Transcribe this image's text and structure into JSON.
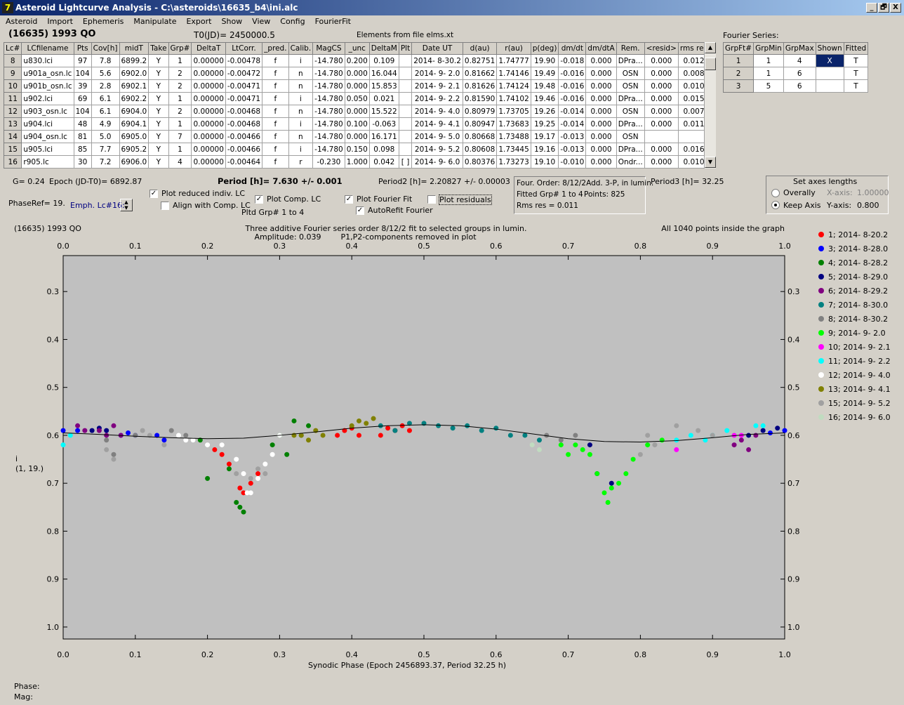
{
  "window": {
    "title": "Asteroid Lightcurve Analysis - C:\\asteroids\\16635_b4\\ini.alc",
    "controls": [
      "_",
      "🗗",
      "X"
    ]
  },
  "menu": [
    "Asteroid",
    "Import",
    "Ephemeris",
    "Manipulate",
    "Export",
    "Show",
    "View",
    "Config",
    "FourierFit"
  ],
  "header": {
    "asteroid": "(16635) 1993 QO",
    "t0": "T0(JD)= 2450000.5",
    "elements": "Elements from file elms.xt"
  },
  "lc_table": {
    "columns": [
      "Lc#",
      "LCfilename",
      "Pts",
      "Cov[h]",
      "midT",
      "Take",
      "Grp#",
      "DeltaT",
      "LtCorr.",
      "_pred.",
      "Calib.",
      "MagCS",
      "_unc",
      "DeltaM",
      "Plt",
      "Date UT",
      "d(au)",
      "r(au)",
      "p(deg)",
      "dm/dt",
      "dm/dtA",
      "Rem.",
      "<resid>",
      "rms res"
    ],
    "rows": [
      [
        "8",
        "u830.lci",
        "97",
        "7.8",
        "6899.2",
        "Y",
        "1",
        "0.00000",
        "-0.00478",
        "f",
        "i",
        "-14.780",
        "0.200",
        "0.109",
        "",
        "2014- 8-30.2",
        "0.82751",
        "1.74777",
        "19.90",
        "-0.018",
        "0.000",
        "DPra...",
        "0.000",
        "0.012"
      ],
      [
        "9",
        "u901a_osn.lc",
        "104",
        "5.6",
        "6902.0",
        "Y",
        "2",
        "0.00000",
        "-0.00472",
        "f",
        "n",
        "-14.780",
        "0.000",
        "16.044",
        "",
        "2014- 9- 2.0",
        "0.81662",
        "1.74146",
        "19.49",
        "-0.016",
        "0.000",
        "OSN",
        "0.000",
        "0.008"
      ],
      [
        "10",
        "u901b_osn.lc",
        "39",
        "2.8",
        "6902.1",
        "Y",
        "2",
        "0.00000",
        "-0.00471",
        "f",
        "n",
        "-14.780",
        "0.000",
        "15.853",
        "",
        "2014- 9- 2.1",
        "0.81626",
        "1.74124",
        "19.48",
        "-0.016",
        "0.000",
        "OSN",
        "0.000",
        "0.010"
      ],
      [
        "11",
        "u902.lci",
        "69",
        "6.1",
        "6902.2",
        "Y",
        "1",
        "0.00000",
        "-0.00471",
        "f",
        "i",
        "-14.780",
        "0.050",
        "0.021",
        "",
        "2014- 9- 2.2",
        "0.81590",
        "1.74102",
        "19.46",
        "-0.016",
        "0.000",
        "DPra...",
        "0.000",
        "0.015"
      ],
      [
        "12",
        "u903_osn.lc",
        "104",
        "6.1",
        "6904.0",
        "Y",
        "2",
        "0.00000",
        "-0.00468",
        "f",
        "n",
        "-14.780",
        "0.000",
        "15.522",
        "",
        "2014- 9- 4.0",
        "0.80979",
        "1.73705",
        "19.26",
        "-0.014",
        "0.000",
        "OSN",
        "0.000",
        "0.007"
      ],
      [
        "13",
        "u904.lci",
        "48",
        "4.9",
        "6904.1",
        "Y",
        "1",
        "0.00000",
        "-0.00468",
        "f",
        "i",
        "-14.780",
        "0.100",
        "-0.063",
        "",
        "2014- 9- 4.1",
        "0.80947",
        "1.73683",
        "19.25",
        "-0.014",
        "0.000",
        "DPra...",
        "0.000",
        "0.011"
      ],
      [
        "14",
        "u904_osn.lc",
        "81",
        "5.0",
        "6905.0",
        "Y",
        "7",
        "0.00000",
        "-0.00466",
        "f",
        "n",
        "-14.780",
        "0.000",
        "16.171",
        "",
        "2014- 9- 5.0",
        "0.80668",
        "1.73488",
        "19.17",
        "-0.013",
        "0.000",
        "OSN",
        "",
        ""
      ],
      [
        "15",
        "u905.lci",
        "85",
        "7.7",
        "6905.2",
        "Y",
        "1",
        "0.00000",
        "-0.00466",
        "f",
        "i",
        "-14.780",
        "0.150",
        "0.098",
        "",
        "2014- 9- 5.2",
        "0.80608",
        "1.73445",
        "19.16",
        "-0.013",
        "0.000",
        "DPra...",
        "0.000",
        "0.016"
      ],
      [
        "16",
        "r905.lc",
        "30",
        "7.2",
        "6906.0",
        "Y",
        "4",
        "0.00000",
        "-0.00464",
        "f",
        "r",
        "-0.230",
        "1.000",
        "0.042",
        "[ ]",
        "2014- 9- 6.0",
        "0.80376",
        "1.73273",
        "19.10",
        "-0.010",
        "0.000",
        "Ondr...",
        "0.000",
        "0.010"
      ]
    ]
  },
  "fourier_panel": {
    "title": "Fourier Series:",
    "columns": [
      "GrpFt#",
      "GrpMin",
      "GrpMax",
      "Shown",
      "Fitted"
    ],
    "rows": [
      [
        "1",
        "1",
        "4",
        "X",
        "T"
      ],
      [
        "2",
        "1",
        "6",
        "",
        "T"
      ],
      [
        "3",
        "5",
        "6",
        "",
        "T"
      ]
    ]
  },
  "info": {
    "g": "G= 0.24",
    "epoch": "Epoch (JD-T0)= 6892.87",
    "period": "Period [h]= 7.630 +/- 0.001",
    "period2": "Period2 [h]= 2.20827 +/- 0.00003",
    "period3": "Period3 [h]= 32.25",
    "phase_ref": "PhaseRef= 19.",
    "emph": "Emph. Lc#16:",
    "pltd_grp": "Pltd Grp#  1   to   4"
  },
  "checkboxes": {
    "reduced": "Plot reduced indiv. LC",
    "align": "Align with Comp. LC",
    "comp": "Plot Comp. LC",
    "fourier": "Plot Fourier Fit",
    "autorefit": "AutoRefit Fourier",
    "residuals": "Plot residuals"
  },
  "fit_box": {
    "line1": "Four. Order:  8/12/2Add. 3-P, in lumin.",
    "line2": "Fitted Grp# 1 to 4",
    "points": "Points: 825",
    "rms": "Rms res      = 0.011"
  },
  "axes_box": {
    "title": "Set axes lengths",
    "overall": "Overally",
    "keep": "Keep Axis",
    "xaxis": "X-axis:",
    "xval": "1.00000",
    "yaxis": "Y-axis:",
    "yval": "0.800"
  },
  "plot": {
    "name": "(16635) 1993 QO",
    "title": "Three additive Fourier series order 8/12/2 fit to selected groups in lumin.",
    "amplitude": "Amplitude: 0.039",
    "removed": "P1,P2-components removed in plot",
    "inside": "All 1040 points inside the graph",
    "ylabel1": "i",
    "ylabel2": "(1, 19.)",
    "xlabel": "Synodic Phase (Epoch 2456893.37, Period 32.25 h)"
  },
  "chart_data": {
    "type": "scatter",
    "x_ticks": [
      "0.0",
      "0.1",
      "0.2",
      "0.3",
      "0.4",
      "0.5",
      "0.6",
      "0.7",
      "0.8",
      "0.9",
      "1.0"
    ],
    "y_ticks": [
      "0.3",
      "0.4",
      "0.5",
      "0.6",
      "0.7",
      "0.8",
      "0.9",
      "1.0"
    ],
    "xlim": [
      0.0,
      1.0
    ],
    "ylim": [
      0.225,
      1.025
    ],
    "y_inverted": true,
    "legend": [
      {
        "label": "1; 2014- 8-20.2",
        "color": "#ff0000"
      },
      {
        "label": "3; 2014- 8-28.0",
        "color": "#0000ff"
      },
      {
        "label": "4; 2014- 8-28.2",
        "color": "#008000"
      },
      {
        "label": "5; 2014- 8-29.0",
        "color": "#000080"
      },
      {
        "label": "6; 2014- 8-29.2",
        "color": "#800080"
      },
      {
        "label": "7; 2014- 8-30.0",
        "color": "#008080"
      },
      {
        "label": "8; 2014- 8-30.2",
        "color": "#808080"
      },
      {
        "label": "9; 2014- 9- 2.0",
        "color": "#00ff00"
      },
      {
        "label": "10; 2014- 9- 2.1",
        "color": "#ff00ff"
      },
      {
        "label": "11; 2014- 9- 2.2",
        "color": "#00ffff"
      },
      {
        "label": "12; 2014- 9- 4.0",
        "color": "#ffffff"
      },
      {
        "label": "13; 2014- 9- 4.1",
        "color": "#808000"
      },
      {
        "label": "15; 2014- 9- 5.2",
        "color": "#a0a0a0"
      },
      {
        "label": "16; 2014- 9- 6.0",
        "color": "#c0dcc0"
      }
    ],
    "fit_curve": [
      [
        0.0,
        0.595
      ],
      [
        0.05,
        0.598
      ],
      [
        0.1,
        0.602
      ],
      [
        0.15,
        0.605
      ],
      [
        0.2,
        0.607
      ],
      [
        0.25,
        0.606
      ],
      [
        0.3,
        0.6
      ],
      [
        0.35,
        0.593
      ],
      [
        0.4,
        0.585
      ],
      [
        0.45,
        0.58
      ],
      [
        0.5,
        0.578
      ],
      [
        0.55,
        0.58
      ],
      [
        0.6,
        0.587
      ],
      [
        0.65,
        0.597
      ],
      [
        0.7,
        0.607
      ],
      [
        0.75,
        0.613
      ],
      [
        0.8,
        0.614
      ],
      [
        0.85,
        0.611
      ],
      [
        0.9,
        0.605
      ],
      [
        0.95,
        0.598
      ],
      [
        1.0,
        0.595
      ]
    ],
    "series": [
      {
        "name": "1; 2014- 8-20.2",
        "color": "#ff0000",
        "points": [
          [
            0.21,
            0.63
          ],
          [
            0.22,
            0.64
          ],
          [
            0.23,
            0.66
          ],
          [
            0.245,
            0.71
          ],
          [
            0.25,
            0.72
          ],
          [
            0.26,
            0.7
          ],
          [
            0.27,
            0.68
          ],
          [
            0.44,
            0.6
          ],
          [
            0.45,
            0.585
          ],
          [
            0.46,
            0.59
          ],
          [
            0.47,
            0.58
          ],
          [
            0.48,
            0.59
          ],
          [
            0.38,
            0.6
          ],
          [
            0.39,
            0.59
          ],
          [
            0.4,
            0.585
          ],
          [
            0.41,
            0.6
          ]
        ]
      },
      {
        "name": "3; 2014- 8-28.0",
        "color": "#0000ff",
        "points": [
          [
            0.0,
            0.59
          ],
          [
            0.02,
            0.59
          ],
          [
            0.08,
            0.6
          ],
          [
            0.09,
            0.595
          ],
          [
            0.1,
            0.6
          ],
          [
            0.13,
            0.6
          ],
          [
            0.14,
            0.61
          ],
          [
            1.0,
            0.59
          ],
          [
            0.98,
            0.595
          ]
        ]
      },
      {
        "name": "4; 2014- 8-28.2",
        "color": "#008000",
        "points": [
          [
            0.19,
            0.61
          ],
          [
            0.2,
            0.69
          ],
          [
            0.23,
            0.67
          ],
          [
            0.24,
            0.74
          ],
          [
            0.245,
            0.75
          ],
          [
            0.25,
            0.76
          ],
          [
            0.29,
            0.62
          ],
          [
            0.3,
            0.6
          ],
          [
            0.31,
            0.64
          ],
          [
            0.33,
            0.6
          ],
          [
            0.32,
            0.57
          ],
          [
            0.34,
            0.58
          ]
        ]
      },
      {
        "name": "5; 2014- 8-29.0",
        "color": "#000080",
        "points": [
          [
            0.04,
            0.59
          ],
          [
            0.05,
            0.585
          ],
          [
            0.06,
            0.59
          ],
          [
            0.95,
            0.6
          ],
          [
            0.97,
            0.59
          ],
          [
            0.99,
            0.585
          ],
          [
            0.73,
            0.62
          ],
          [
            0.74,
            0.68
          ],
          [
            0.76,
            0.7
          ]
        ]
      },
      {
        "name": "6; 2014- 8-29.2",
        "color": "#800080",
        "points": [
          [
            0.02,
            0.58
          ],
          [
            0.03,
            0.59
          ],
          [
            0.05,
            0.59
          ],
          [
            0.06,
            0.6
          ],
          [
            0.07,
            0.58
          ],
          [
            0.08,
            0.6
          ],
          [
            0.93,
            0.62
          ],
          [
            0.94,
            0.61
          ],
          [
            0.95,
            0.63
          ],
          [
            0.96,
            0.6
          ]
        ]
      },
      {
        "name": "7; 2014- 8-30.0",
        "color": "#008080",
        "points": [
          [
            0.44,
            0.58
          ],
          [
            0.46,
            0.59
          ],
          [
            0.48,
            0.575
          ],
          [
            0.5,
            0.575
          ],
          [
            0.52,
            0.58
          ],
          [
            0.54,
            0.585
          ],
          [
            0.56,
            0.58
          ],
          [
            0.58,
            0.59
          ],
          [
            0.6,
            0.585
          ],
          [
            0.62,
            0.6
          ],
          [
            0.64,
            0.6
          ],
          [
            0.66,
            0.61
          ]
        ]
      },
      {
        "name": "8; 2014- 8-30.2",
        "color": "#808080",
        "points": [
          [
            0.06,
            0.61
          ],
          [
            0.07,
            0.64
          ],
          [
            0.1,
            0.6
          ],
          [
            0.15,
            0.59
          ],
          [
            0.17,
            0.6
          ],
          [
            0.18,
            0.61
          ],
          [
            0.67,
            0.6
          ],
          [
            0.69,
            0.61
          ],
          [
            0.71,
            0.6
          ]
        ]
      },
      {
        "name": "9; 2014- 9- 2.0",
        "color": "#00ff00",
        "points": [
          [
            0.69,
            0.62
          ],
          [
            0.7,
            0.64
          ],
          [
            0.71,
            0.62
          ],
          [
            0.72,
            0.63
          ],
          [
            0.73,
            0.64
          ],
          [
            0.74,
            0.68
          ],
          [
            0.75,
            0.72
          ],
          [
            0.755,
            0.74
          ],
          [
            0.76,
            0.71
          ],
          [
            0.77,
            0.7
          ],
          [
            0.78,
            0.68
          ],
          [
            0.79,
            0.65
          ],
          [
            0.81,
            0.62
          ],
          [
            0.83,
            0.61
          ]
        ]
      },
      {
        "name": "10; 2014- 9- 2.1",
        "color": "#ff00ff",
        "points": [
          [
            0.85,
            0.63
          ],
          [
            0.93,
            0.6
          ],
          [
            0.94,
            0.6
          ]
        ]
      },
      {
        "name": "11; 2014- 9- 2.2",
        "color": "#00ffff",
        "points": [
          [
            0.0,
            0.62
          ],
          [
            0.01,
            0.6
          ],
          [
            0.85,
            0.61
          ],
          [
            0.87,
            0.6
          ],
          [
            0.89,
            0.61
          ],
          [
            0.9,
            0.6
          ],
          [
            0.92,
            0.59
          ],
          [
            0.96,
            0.58
          ],
          [
            0.97,
            0.58
          ]
        ]
      },
      {
        "name": "12; 2014- 9- 4.0",
        "color": "#ffffff",
        "points": [
          [
            0.16,
            0.6
          ],
          [
            0.17,
            0.61
          ],
          [
            0.18,
            0.61
          ],
          [
            0.2,
            0.62
          ],
          [
            0.22,
            0.62
          ],
          [
            0.24,
            0.65
          ],
          [
            0.25,
            0.68
          ],
          [
            0.255,
            0.72
          ],
          [
            0.26,
            0.72
          ],
          [
            0.27,
            0.69
          ],
          [
            0.28,
            0.66
          ],
          [
            0.29,
            0.64
          ],
          [
            0.3,
            0.6
          ]
        ]
      },
      {
        "name": "13; 2014- 9- 4.1",
        "color": "#808000",
        "points": [
          [
            0.32,
            0.6
          ],
          [
            0.33,
            0.6
          ],
          [
            0.34,
            0.61
          ],
          [
            0.35,
            0.59
          ],
          [
            0.36,
            0.6
          ],
          [
            0.4,
            0.58
          ],
          [
            0.41,
            0.57
          ],
          [
            0.42,
            0.575
          ],
          [
            0.43,
            0.565
          ]
        ]
      },
      {
        "name": "15; 2014- 9- 5.2",
        "color": "#a0a0a0",
        "points": [
          [
            0.06,
            0.63
          ],
          [
            0.07,
            0.65
          ],
          [
            0.11,
            0.59
          ],
          [
            0.12,
            0.6
          ],
          [
            0.14,
            0.62
          ],
          [
            0.24,
            0.68
          ],
          [
            0.26,
            0.69
          ],
          [
            0.27,
            0.67
          ],
          [
            0.28,
            0.68
          ],
          [
            0.8,
            0.64
          ],
          [
            0.81,
            0.6
          ],
          [
            0.82,
            0.62
          ],
          [
            0.85,
            0.58
          ],
          [
            0.88,
            0.59
          ],
          [
            0.9,
            0.6
          ]
        ]
      },
      {
        "name": "16; 2014- 9- 6.0",
        "color": "#c0dcc0",
        "points": [
          [
            0.65,
            0.62
          ],
          [
            0.66,
            0.63
          ]
        ]
      }
    ]
  },
  "status": {
    "phase": "Phase:",
    "mag": "Mag:"
  }
}
